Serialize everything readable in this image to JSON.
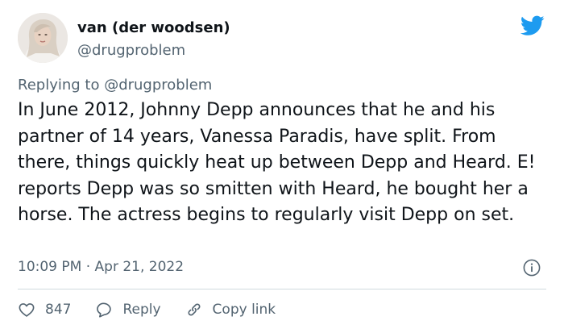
{
  "author": {
    "display_name": "van (der woodsen)",
    "handle": "@drugproblem"
  },
  "reply_context": "Replying to @drugproblem",
  "tweet_text": "In June 2012, Johnny Depp announces that he and his partner of 14 years, Vanessa Paradis, have split. From there, things quickly heat up between Depp and Heard. E! reports Depp was so smitten with Heard, he bought her a horse. The actress begins to regularly visit Depp on set.",
  "timestamp": "10:09 PM · Apr 21, 2022",
  "actions": {
    "like_count": "847",
    "reply_label": "Reply",
    "copy_link_label": "Copy link"
  },
  "icons": {
    "brand": "twitter-bird-icon",
    "info": "info-icon",
    "like": "heart-icon",
    "reply": "speech-bubble-icon",
    "copy_link": "link-icon"
  },
  "colors": {
    "brand": "#1d9bf0",
    "text": "#0f1419",
    "secondary_text": "#536471",
    "divider": "#cfd9de"
  }
}
